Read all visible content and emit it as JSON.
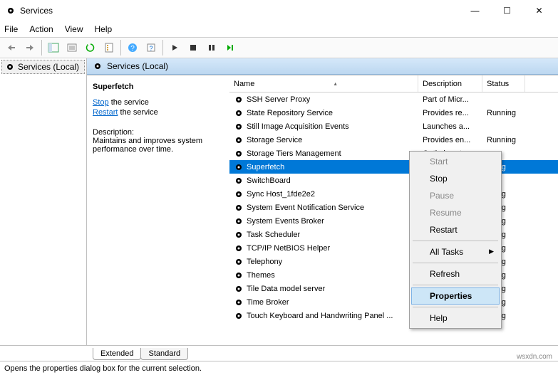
{
  "window": {
    "title": "Services",
    "min": "—",
    "max": "☐",
    "close": "✕"
  },
  "menubar": [
    "File",
    "Action",
    "View",
    "Help"
  ],
  "leftpane": {
    "item": "Services (Local)"
  },
  "header2": "Services (Local)",
  "detail": {
    "name": "Superfetch",
    "stop": "Stop",
    "stop_suffix": " the service",
    "restart": "Restart",
    "restart_suffix": " the service",
    "desc_label": "Description:",
    "desc": "Maintains and improves system performance over time."
  },
  "columns": {
    "name": "Name",
    "desc": "Description",
    "status": "Status",
    "sort": "▴"
  },
  "services": [
    {
      "name": "SSH Server Proxy",
      "desc": "Part of Micr...",
      "status": ""
    },
    {
      "name": "State Repository Service",
      "desc": "Provides re...",
      "status": "Running"
    },
    {
      "name": "Still Image Acquisition Events",
      "desc": "Launches a...",
      "status": ""
    },
    {
      "name": "Storage Service",
      "desc": "Provides en...",
      "status": "Running"
    },
    {
      "name": "Storage Tiers Management",
      "desc": "Optimizes t...",
      "status": ""
    },
    {
      "name": "Superfetch",
      "desc": "",
      "status": "nning",
      "selected": true
    },
    {
      "name": "SwitchBoard",
      "desc": "",
      "status": ""
    },
    {
      "name": "Sync Host_1fde2e2",
      "desc": "",
      "status": "nning"
    },
    {
      "name": "System Event Notification Service",
      "desc": "",
      "status": "nning"
    },
    {
      "name": "System Events Broker",
      "desc": "",
      "status": "nning"
    },
    {
      "name": "Task Scheduler",
      "desc": "",
      "status": "nning"
    },
    {
      "name": "TCP/IP NetBIOS Helper",
      "desc": "",
      "status": "nning"
    },
    {
      "name": "Telephony",
      "desc": "",
      "status": "nning"
    },
    {
      "name": "Themes",
      "desc": "",
      "status": "nning"
    },
    {
      "name": "Tile Data model server",
      "desc": "",
      "status": "nning"
    },
    {
      "name": "Time Broker",
      "desc": "",
      "status": "nning"
    },
    {
      "name": "Touch Keyboard and Handwriting Panel ...",
      "desc": "",
      "status": "nning"
    }
  ],
  "context_menu": {
    "items": [
      {
        "label": "Start",
        "disabled": true
      },
      {
        "label": "Stop"
      },
      {
        "label": "Pause",
        "disabled": true
      },
      {
        "label": "Resume",
        "disabled": true
      },
      {
        "label": "Restart"
      }
    ],
    "all_tasks": "All Tasks",
    "refresh": "Refresh",
    "properties": "Properties",
    "help": "Help"
  },
  "tabs": {
    "extended": "Extended",
    "standard": "Standard"
  },
  "statusbar": "Opens the properties dialog box for the current selection.",
  "watermark": "wsxdn.com"
}
